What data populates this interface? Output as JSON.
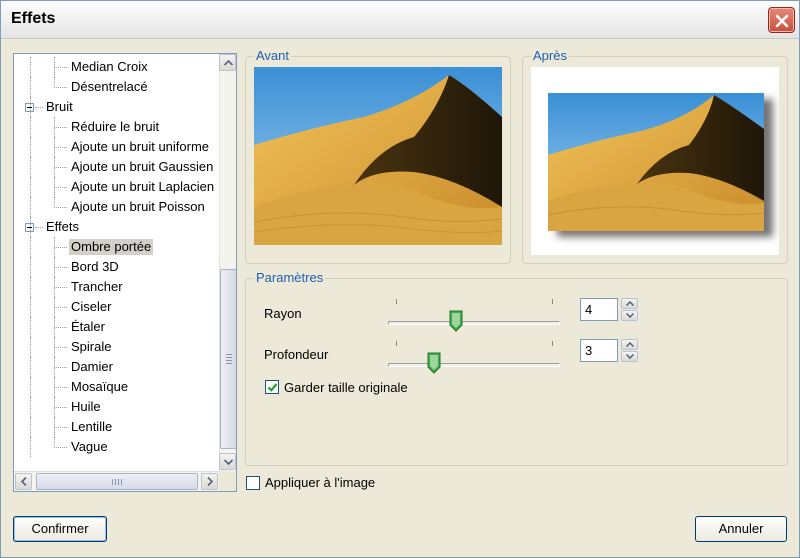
{
  "window": {
    "title": "Effets"
  },
  "tree": {
    "items": [
      {
        "label": "Median Croix",
        "level": 2
      },
      {
        "label": "Désentrelacé",
        "level": 2
      },
      {
        "label": "Bruit",
        "level": 1,
        "expanded": true
      },
      {
        "label": "Réduire le bruit",
        "level": 2
      },
      {
        "label": "Ajoute un bruit uniforme",
        "level": 2
      },
      {
        "label": "Ajoute un bruit Gaussien",
        "level": 2
      },
      {
        "label": "Ajoute un bruit Laplacien",
        "level": 2
      },
      {
        "label": "Ajoute un bruit Poisson",
        "level": 2
      },
      {
        "label": "Effets",
        "level": 1,
        "expanded": true
      },
      {
        "label": "Ombre portée",
        "level": 2,
        "selected": true
      },
      {
        "label": "Bord 3D",
        "level": 2
      },
      {
        "label": "Trancher",
        "level": 2
      },
      {
        "label": "Ciseler",
        "level": 2
      },
      {
        "label": "Étaler",
        "level": 2
      },
      {
        "label": "Spirale",
        "level": 2
      },
      {
        "label": "Damier",
        "level": 2
      },
      {
        "label": "Mosaïque",
        "level": 2
      },
      {
        "label": "Huile",
        "level": 2
      },
      {
        "label": "Lentille",
        "level": 2
      },
      {
        "label": "Vague",
        "level": 2
      }
    ]
  },
  "preview": {
    "before_label": "Avant",
    "after_label": "Après"
  },
  "params": {
    "group_label": "Paramètres",
    "rayon": {
      "label": "Rayon",
      "value": "4",
      "level": 0.4
    },
    "profondeur": {
      "label": "Profondeur",
      "value": "3",
      "level": 0.25
    },
    "keep_size": {
      "label": "Garder taille originale",
      "checked": true
    }
  },
  "apply_to_image": {
    "label": "Appliquer à l'image",
    "checked": false
  },
  "buttons": {
    "confirm": "Confirmer",
    "cancel": "Annuler"
  },
  "colors": {
    "group_label": "#1f5fb0",
    "close_button": "#c94d3a",
    "selection": "#d4d0c8",
    "slider_thumb": "#3fae4a"
  }
}
